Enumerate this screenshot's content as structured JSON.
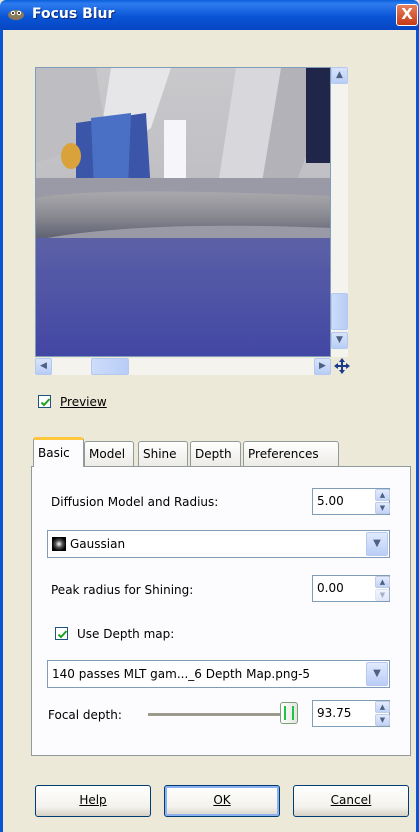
{
  "window": {
    "title": "Focus Blur",
    "close_glyph": "X"
  },
  "preview": {
    "label": "Preview",
    "checked": true
  },
  "tabs": [
    {
      "label": "Basic",
      "active": true
    },
    {
      "label": "Model",
      "active": false
    },
    {
      "label": "Shine",
      "active": false
    },
    {
      "label": "Depth",
      "active": false
    },
    {
      "label": "Preferences",
      "active": false
    }
  ],
  "basic": {
    "diffusion_label": "Diffusion Model and Radius:",
    "diffusion_value": "5.00",
    "model_value": "Gaussian",
    "peak_label": "Peak radius for Shining:",
    "peak_value": "0.00",
    "use_depth_label": "Use Depth map:",
    "use_depth_checked": true,
    "depth_map_value": "140 passes MLT gam..._6 Depth Map.png-5",
    "focal_label": "Focal depth:",
    "focal_value": "93.75",
    "focal_slider_fraction": 0.9375
  },
  "buttons": {
    "help": "Help",
    "ok": "OK",
    "cancel": "Cancel"
  },
  "colors": {
    "titlebar": "#0a55d6",
    "dialog_bg": "#ece9d8",
    "accent_tab": "#ffc83c"
  }
}
